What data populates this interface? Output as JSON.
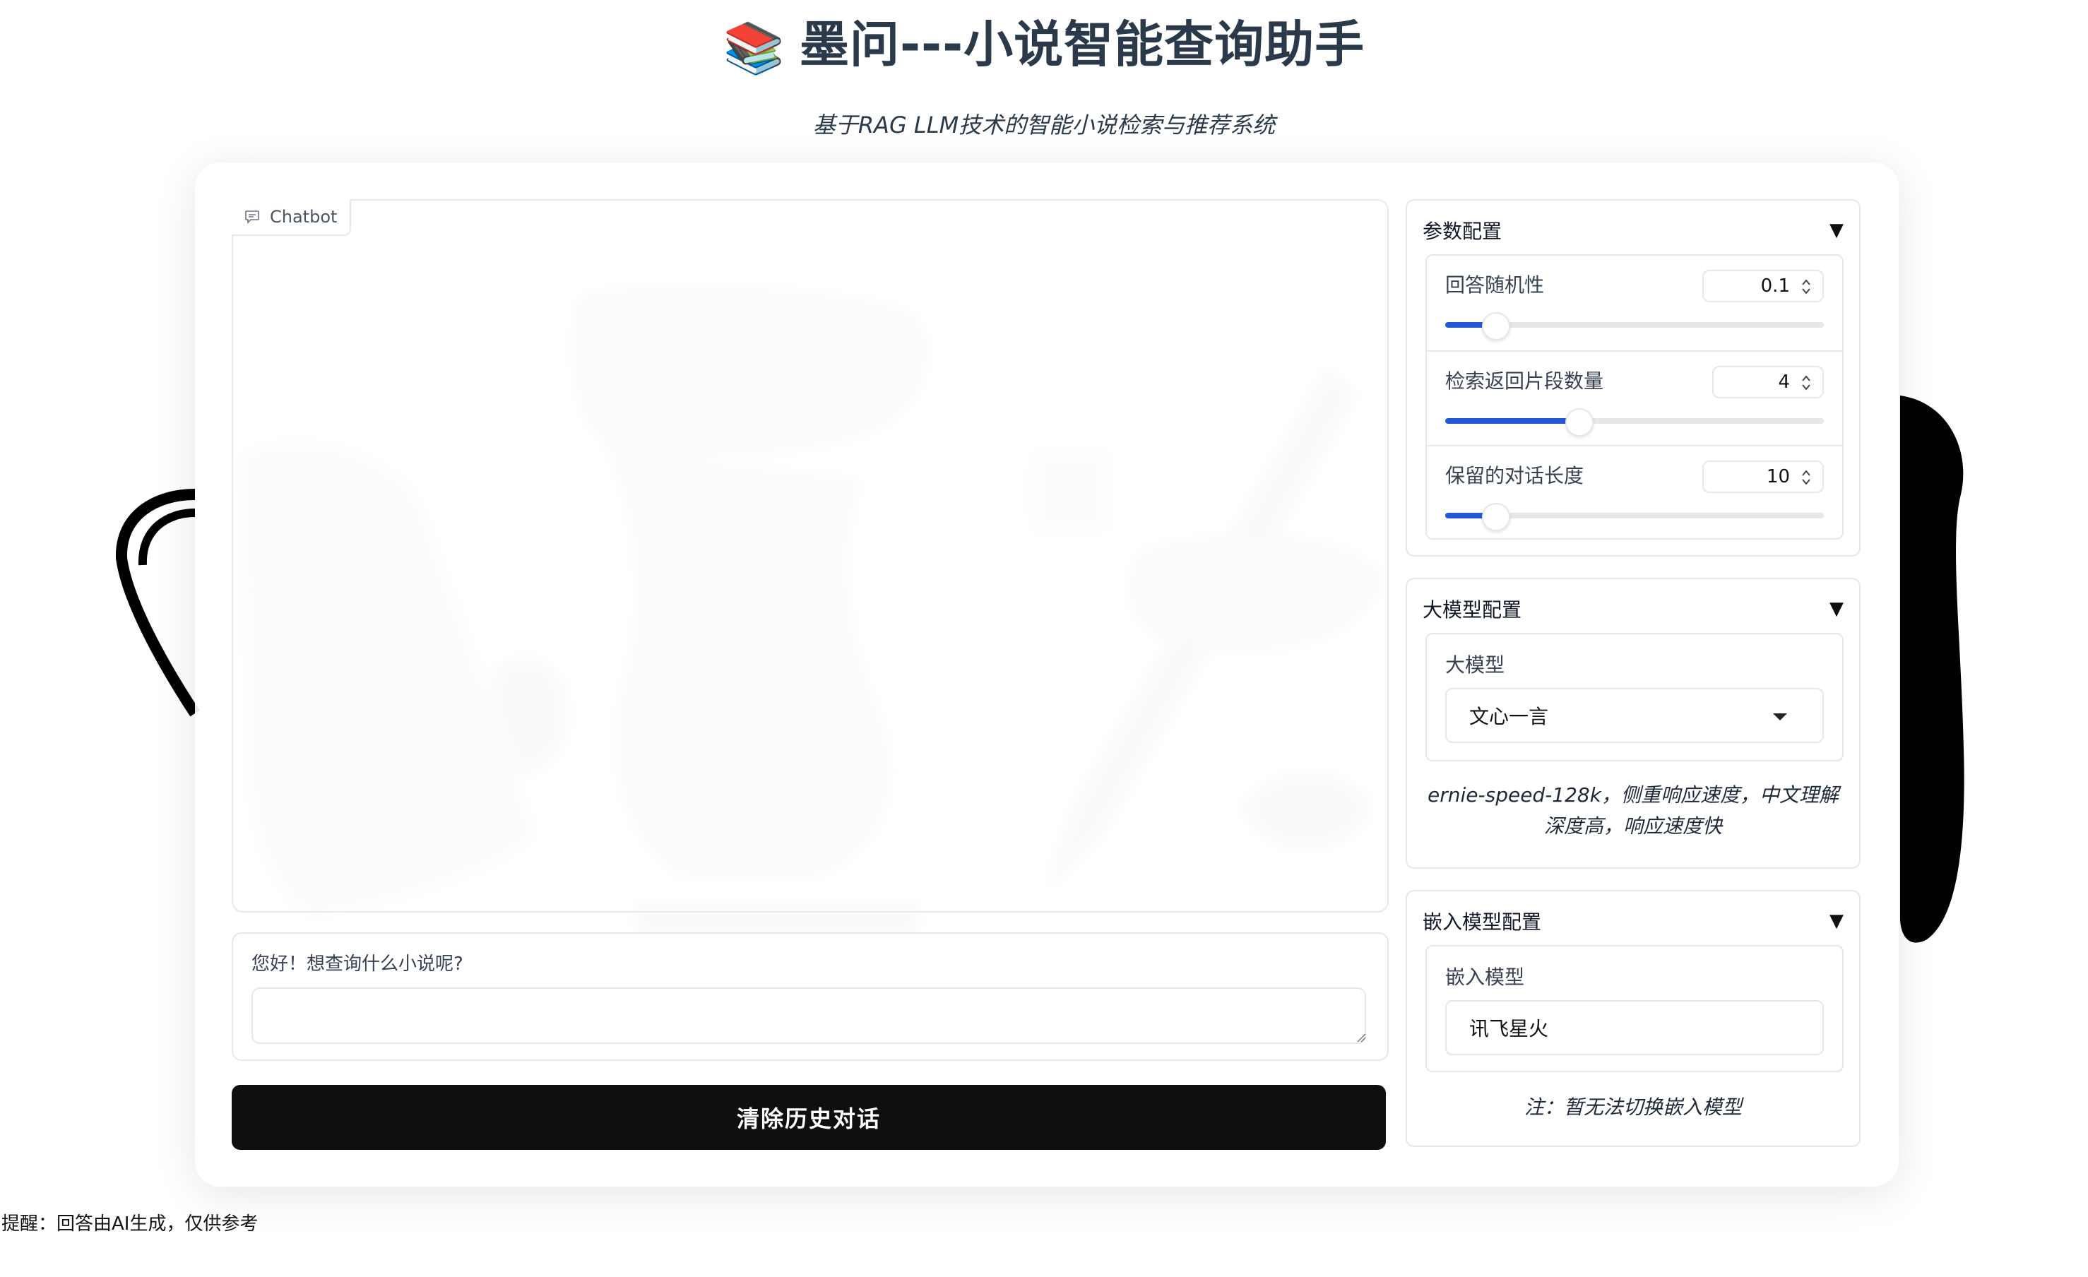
{
  "header": {
    "emoji": "📚",
    "title": "墨问---小说智能查询助手",
    "subtitle": "基于RAG LLM技术的智能小说检索与推荐系统"
  },
  "chat": {
    "label": "Chatbot",
    "input_label": "您好！想查询什么小说呢?",
    "input_value": "",
    "clear_button": "清除历史对话"
  },
  "params": {
    "title": "参数配置",
    "toggle": "▼",
    "sliders": [
      {
        "label": "回答随机性",
        "value": "0.1",
        "fraction": 0.13
      },
      {
        "label": "检索返回片段数量",
        "value": "4",
        "fraction": 0.35
      },
      {
        "label": "保留的对话长度",
        "value": "10",
        "fraction": 0.13
      }
    ]
  },
  "llm": {
    "title": "大模型配置",
    "toggle": "▼",
    "field_label": "大模型",
    "selected": "文心一言",
    "note": "ernie-speed-128k，侧重响应速度，中文理解深度高，响应速度快"
  },
  "embed": {
    "title": "嵌入模型配置",
    "toggle": "▼",
    "field_label": "嵌入模型",
    "value": "讯飞星火",
    "note": "注：暂无法切换嵌入模型"
  },
  "footer": {
    "note": "提醒：回答由AI生成，仅供参考"
  },
  "colors": {
    "accent": "#2357d6",
    "button_bg": "#0f0f0f",
    "title_color": "#2b3a4a"
  }
}
